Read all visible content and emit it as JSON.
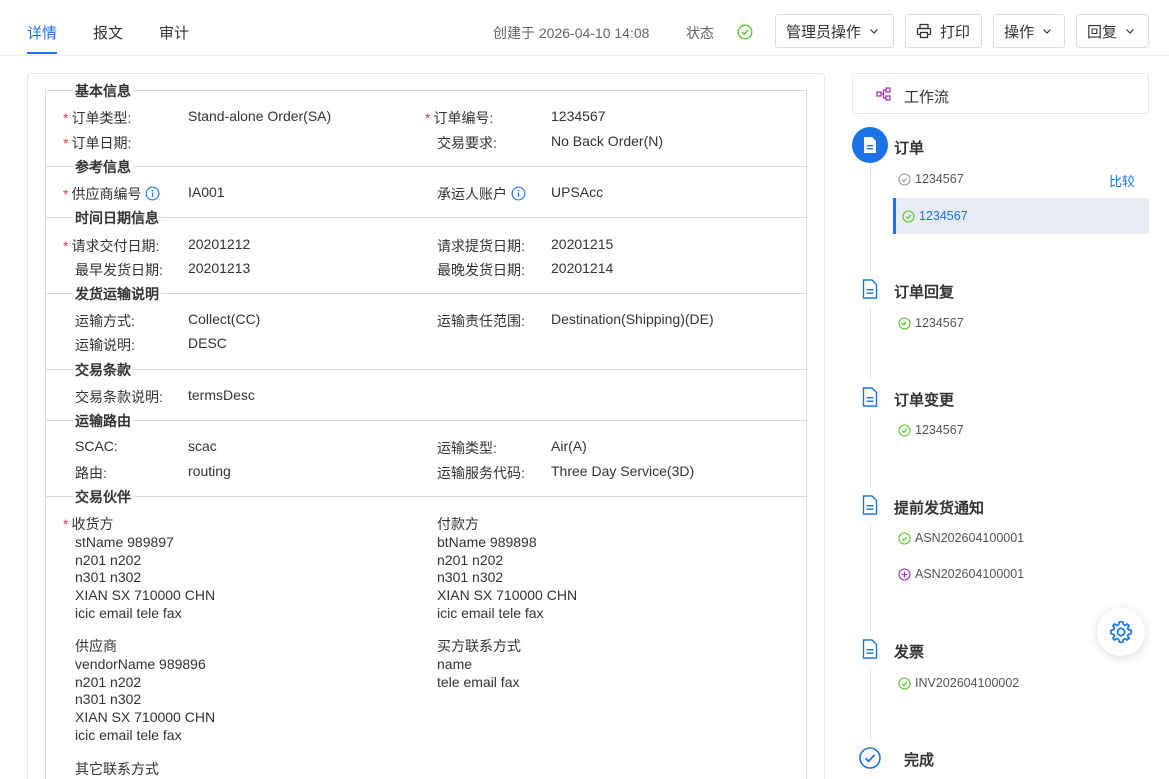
{
  "tabs": [
    {
      "label": "详情",
      "active": true
    },
    {
      "label": "报文",
      "active": false
    },
    {
      "label": "审计",
      "active": false
    }
  ],
  "header": {
    "created": "创建于 2026-04-10 14:08",
    "status_label": "状态",
    "status_icon": "check-circle-icon",
    "buttons": {
      "admin": "管理员操作",
      "print": "打印",
      "actions": "操作",
      "reply": "回复"
    }
  },
  "colors": {
    "accent": "#1a73e8",
    "required": "#e53935",
    "success": "#52c41a",
    "purple": "#9c27b0"
  },
  "sections": {
    "basic": {
      "title": "基本信息",
      "order_type_label": "订单类型:",
      "order_type": "Stand-alone Order(SA)",
      "order_no_label": "订单编号:",
      "order_no": "1234567",
      "order_date_label": "订单日期:",
      "trade_req_label": "交易要求:",
      "trade_req": "No Back Order(N)"
    },
    "reference": {
      "title": "参考信息",
      "vendor_no_label": "供应商编号",
      "vendor_no": "IA001",
      "carrier_acc_label": "承运人账户",
      "carrier_acc": "UPSAcc"
    },
    "dates": {
      "title": "时间日期信息",
      "req_delivery_label": "请求交付日期:",
      "req_delivery": "20201212",
      "req_pickup_label": "请求提货日期:",
      "req_pickup": "20201215",
      "earliest_ship_label": "最早发货日期:",
      "earliest_ship": "20201213",
      "latest_ship_label": "最晚发货日期:",
      "latest_ship": "20201214"
    },
    "shipping": {
      "title": "发货运输说明",
      "method_label": "运输方式:",
      "method": "Collect(CC)",
      "scope_label": "运输责任范围:",
      "scope": "Destination(Shipping)(DE)",
      "desc_label": "运输说明:",
      "desc": "DESC"
    },
    "terms": {
      "title": "交易条款",
      "desc_label": "交易条款说明:",
      "desc": "termsDesc"
    },
    "routing": {
      "title": "运输路由",
      "scac_label": "SCAC:",
      "scac": "scac",
      "type_label": "运输类型:",
      "type": "Air(A)",
      "route_label": "路由:",
      "route": "routing",
      "service_label": "运输服务代码:",
      "service": "Three Day Service(3D)"
    },
    "partners": {
      "title": "交易伙伴",
      "ship_to_label": "收货方",
      "ship_to": "stName 989897\nn201 n202\nn301 n302\nXIAN SX 710000 CHN\nicic email tele fax",
      "bill_to_label": "付款方",
      "bill_to": "btName 989898\nn201 n202\nn301 n302\nXIAN SX 710000 CHN\nicic email tele fax",
      "vendor_label": "供应商",
      "vendor": "vendorName 989896\nn201 n202\nn301 n302\nXIAN SX 710000 CHN\nicic email tele fax",
      "buyer_contact_label": "买方联系方式",
      "buyer_contact": "name\ntele email fax",
      "other_contact_label": "其它联系方式"
    }
  },
  "workflow": {
    "title": "工作流",
    "compare": "比较",
    "steps": [
      {
        "title": "订单",
        "items": [
          "1234567",
          "1234567"
        ]
      },
      {
        "title": "订单回复",
        "items": [
          "1234567"
        ]
      },
      {
        "title": "订单变更",
        "items": [
          "1234567"
        ]
      },
      {
        "title": "提前发货通知",
        "items": [
          "ASN202604100001",
          "ASN202604100001"
        ]
      },
      {
        "title": "发票",
        "items": [
          "INV202604100002"
        ]
      },
      {
        "title": "完成",
        "items": []
      }
    ]
  }
}
